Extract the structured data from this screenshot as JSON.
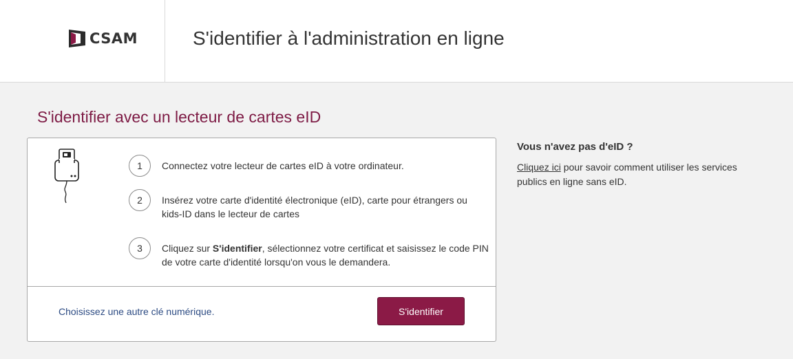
{
  "header": {
    "logo_text": "CSAM",
    "title": "S'identifier à l'administration en ligne"
  },
  "main": {
    "section_title": "S'identifier avec un lecteur de cartes eID",
    "steps": [
      {
        "number": "1",
        "text": "Connectez votre lecteur de cartes eID à votre ordinateur."
      },
      {
        "number": "2",
        "text": "Insérez votre carte d'identité électronique (eID), carte pour étrangers ou kids-ID dans le lecteur de cartes"
      },
      {
        "number": "3",
        "text_before": "Cliquez sur ",
        "text_bold": "S'identifier",
        "text_after": ", sélectionnez votre certificat et saisissez le code PIN de votre carte d'identité lorsqu'on vous le demandera."
      }
    ],
    "alt_link": "Choisissez une autre clé numérique.",
    "login_button": "S'identifier"
  },
  "sidebar": {
    "title": "Vous n'avez pas d'eID ?",
    "link": "Cliquez ici",
    "text": " pour savoir comment utiliser les services publics en ligne sans eID."
  },
  "icons": {
    "logo": "csam-door-icon",
    "reader": "card-reader-icon"
  },
  "colors": {
    "accent": "#7d1a44",
    "button": "#8b1a46",
    "link": "#2b4a82"
  }
}
